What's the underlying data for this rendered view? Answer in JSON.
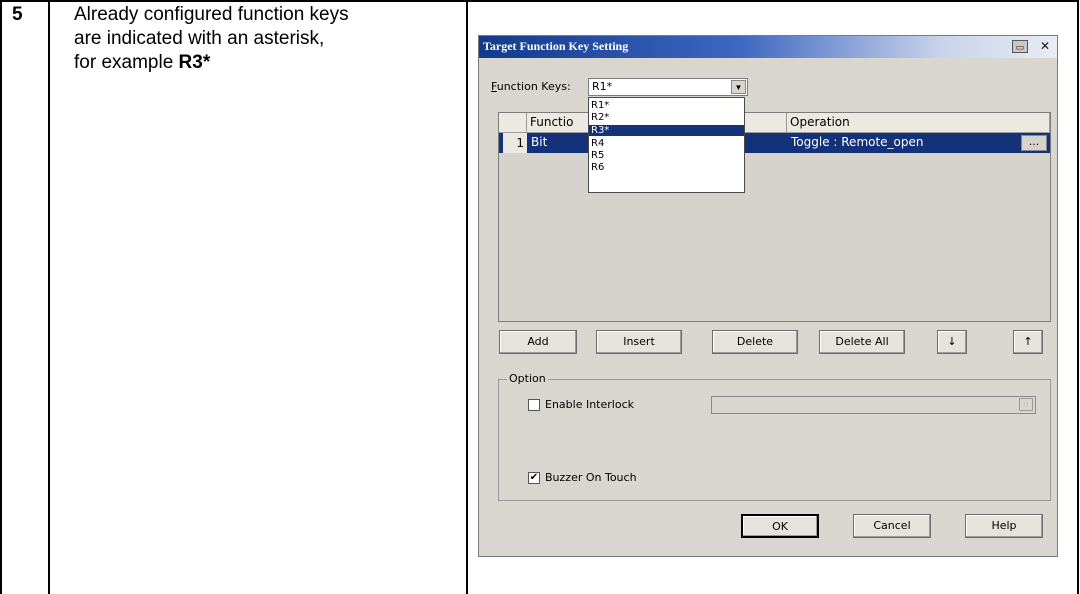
{
  "step": {
    "number": "5",
    "text_lines": [
      "Already configured function keys",
      "are indicated with an asterisk,"
    ],
    "example_prefix": "for example ",
    "example_value": "R3*"
  },
  "dialog": {
    "title": "Target Function Key Setting",
    "function_keys_label_accel": "F",
    "function_keys_label_rest": "unction Keys:",
    "function_keys_value": "R1*",
    "dropdown_items": [
      "R1*",
      "R2*",
      "R3*",
      "R4",
      "R5",
      "R6"
    ],
    "dropdown_selected": "R3*",
    "columns": {
      "function": "Functio",
      "operation": "Operation"
    },
    "rows": [
      {
        "index": "1",
        "function": "Bit",
        "operation": "Toggle : Remote_open",
        "edit": "..."
      }
    ],
    "buttons": {
      "add": "Add",
      "insert": "Insert",
      "delete": "Delete",
      "delete_all": "Delete All",
      "move_down": "↓",
      "move_up": "↑",
      "ok": "OK",
      "cancel": "Cancel",
      "help": "Help"
    },
    "option_group": "Option",
    "enable_interlock": "Enable Interlock",
    "buzzer_on_touch": "Buzzer On Touch",
    "buzzer_checked": true,
    "interlock_checked": false
  },
  "colors": {
    "selection": "#14327a",
    "dialog_bg": "#d9d6cf",
    "title_start": "#123a8a"
  }
}
